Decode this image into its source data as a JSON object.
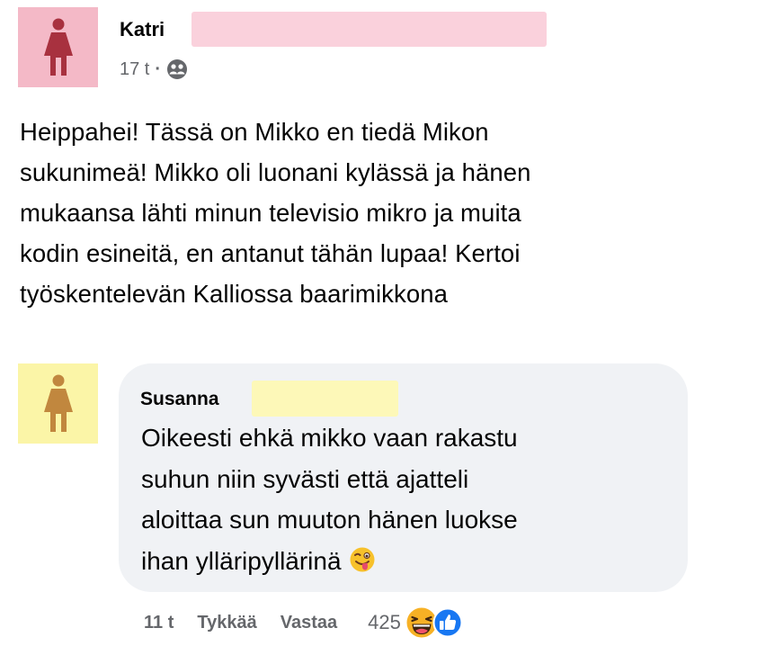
{
  "post": {
    "author": "Katri",
    "time": "17 t",
    "separator": "·",
    "audience_icon": "friends-icon",
    "text": "Heippahei! Tässä on Mikko en tiedä Mikon\nsukunimeä! Mikko oli luonani kylässä ja hänen\nmukaansa lähti minun televisio mikro ja muita\nkodin esineitä, en antanut tähän lupaa! Kertoi\ntyöskentelevän Kalliossa baarimikkona",
    "avatar_color": "#f4b9c7",
    "redaction_color": "#fad1dc"
  },
  "comment": {
    "author": "Susanna",
    "text": "Oikeesti ehkä mikko vaan rakastu\nsuhun niin syvästi että ajatteli\naloittaa sun muuton hänen luokse\nihan ylläripyllärinä",
    "emoji": "winking-tongue-emoji",
    "time": "11 t",
    "like_label": "Tykkää",
    "reply_label": "Vastaa",
    "reaction_count": "425",
    "reactions": [
      "haha-icon",
      "like-icon"
    ],
    "avatar_color": "#fbf5a7",
    "redaction_color": "#fdf8b8",
    "bubble_color": "#f0f2f5"
  },
  "colors": {
    "text": "#050505",
    "secondary_text": "#65676b",
    "like_blue": "#1877f2",
    "haha_yellow": "#f7b125"
  }
}
